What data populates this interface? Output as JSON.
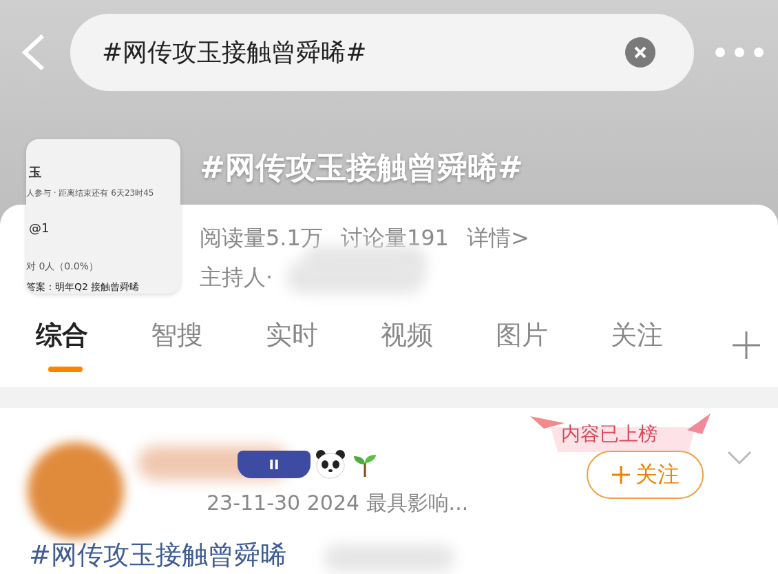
{
  "search": {
    "value": "#网传攻玉接触曾舜晞#"
  },
  "topic": {
    "title": "#网传攻玉接触曾舜晞#",
    "thumbnail": {
      "heading": "玉",
      "meta": "人参与 · 距离结束还有 6天23时45",
      "option": "@1",
      "result": "对 0人（0.0%）",
      "answer": "答案：明年Q2 接触曾舜晞"
    },
    "stats": [
      "阅读量5.1万",
      "讨论量191",
      "详情>"
    ],
    "host": "主持人·"
  },
  "tabs": [
    {
      "label": "综合",
      "selected": true
    },
    {
      "label": "智搜",
      "selected": false
    },
    {
      "label": "实时",
      "selected": false
    },
    {
      "label": "视频",
      "selected": false
    },
    {
      "label": "图片",
      "selected": false
    },
    {
      "label": "关注",
      "selected": false
    }
  ],
  "post": {
    "level_badge": "II",
    "ribbon": "内容已上榜",
    "follow": "关注",
    "meta": "23-11-30  2024 最具影响...",
    "text": "#网传攻玉接触曾舜晞"
  }
}
